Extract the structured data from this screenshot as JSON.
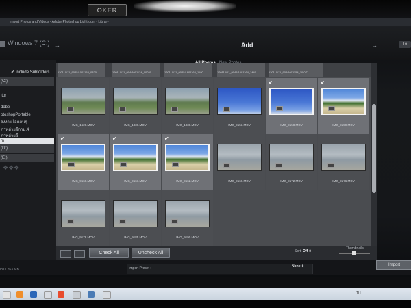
{
  "window": {
    "monitor_brand": "OKER",
    "title": "Import Photos and Videos - Adobe Photoshop Lightroom - Library"
  },
  "header": {
    "source": "Windows 7 (C:)",
    "mode": "Add",
    "dest_badge": "To"
  },
  "left_panel": {
    "include_subfolders": "Include Subfolders",
    "folders": [
      "(C:)",
      "itor",
      "dobe",
      "otoshopPortable",
      "ลงงานไอคอนๆ",
      "ภาพถ่ายอีกาม.4",
      "ภาพถ่ายอี",
      "m",
      "(D:)",
      "(E:)"
    ]
  },
  "tabs": {
    "all": "All Photos",
    "new": "New Photos"
  },
  "top_strip_captions": [
    "120110/11_9045/1001154_0320..",
    "120110/11_904/1001124_00030...",
    "120110/11_9045/1901164_1180...",
    "120110/11_9045/1001164_1440...",
    "120110/11_904/1001154_10.0Z7..."
  ],
  "grid": [
    {
      "name": "IMG_1628.MOV",
      "checked": false,
      "scene": "garden"
    },
    {
      "name": "IMG_1836.MOV",
      "checked": false,
      "scene": "garden"
    },
    {
      "name": "IMG_1838.MOV",
      "checked": false,
      "scene": "garden"
    },
    {
      "name": "IMG_9153.MOV",
      "checked": false,
      "scene": "sky"
    },
    {
      "name": "IMG_9158.MOV",
      "checked": true,
      "scene": "sky"
    },
    {
      "name": "IMG_9159.MOV",
      "checked": true,
      "scene": "beach"
    },
    {
      "name": "IMG_9160.MOV",
      "checked": true,
      "scene": "beach"
    },
    {
      "name": "IMG_9161.MOV",
      "checked": true,
      "scene": "beach"
    },
    {
      "name": "IMG_9162.MOV",
      "checked": true,
      "scene": "beach"
    },
    {
      "name": "IMG_9166.MOV",
      "checked": false,
      "scene": "shore"
    },
    {
      "name": "IMG_9172.MOV",
      "checked": false,
      "scene": "shore"
    },
    {
      "name": "IMG_9176.MOV",
      "checked": false,
      "scene": "shore"
    },
    {
      "name": "IMG_9178.MOV",
      "checked": false,
      "scene": "shore"
    },
    {
      "name": "IMG_9185.MOV",
      "checked": false,
      "scene": "shore"
    },
    {
      "name": "IMG_9190.MOV",
      "checked": false,
      "scene": "shore"
    }
  ],
  "toolbar": {
    "check_all": "Check All",
    "uncheck_all": "Uncheck All",
    "sort_label": "Sort:",
    "sort_value": "Off ⇕",
    "thumbnails": "Thumbnails"
  },
  "bottom": {
    "import": "Import",
    "preset_label": "Import Preset :",
    "preset_value": "None ⇕",
    "size": "ios / 263 MB"
  },
  "taskbar": {
    "clock": "TH"
  }
}
